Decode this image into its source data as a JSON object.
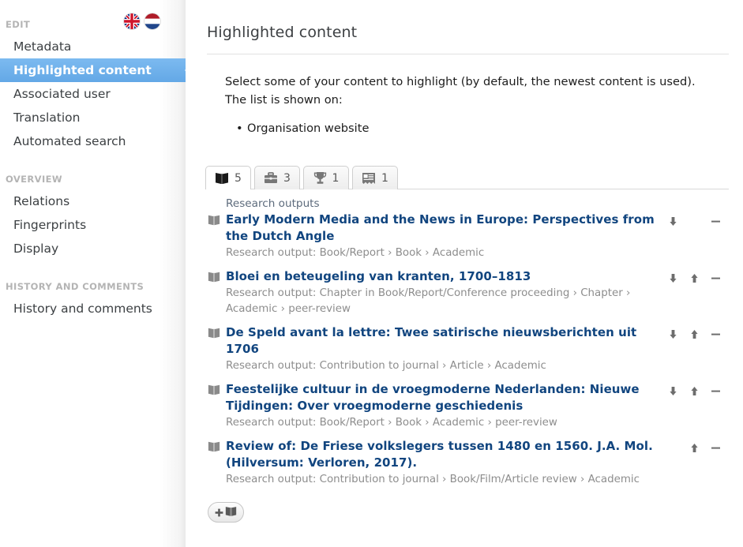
{
  "sidebar": {
    "flags": [
      {
        "name": "flag-uk",
        "label": "English"
      },
      {
        "name": "flag-nl",
        "label": "Nederlands"
      }
    ],
    "groups": [
      {
        "label": "EDIT",
        "items": [
          {
            "label": "Metadata",
            "selected": false
          },
          {
            "label": "Highlighted content",
            "selected": true
          },
          {
            "label": "Associated user",
            "selected": false
          },
          {
            "label": "Translation",
            "selected": false
          },
          {
            "label": "Automated search",
            "selected": false
          }
        ]
      },
      {
        "label": "OVERVIEW",
        "items": [
          {
            "label": "Relations",
            "selected": false
          },
          {
            "label": "Fingerprints",
            "selected": false
          },
          {
            "label": "Display",
            "selected": false
          }
        ]
      },
      {
        "label": "HISTORY AND COMMENTS",
        "items": [
          {
            "label": "History and comments",
            "selected": false
          }
        ]
      }
    ]
  },
  "main": {
    "title": "Highlighted content",
    "intro": "Select some of your content to highlight (by default, the newest content is used). The list is shown on:",
    "bullets": [
      "Organisation website"
    ],
    "tabs": [
      {
        "icon": "book-icon",
        "count": "5",
        "active": true
      },
      {
        "icon": "briefcase-icon",
        "count": "3",
        "active": false
      },
      {
        "icon": "trophy-icon",
        "count": "1",
        "active": false
      },
      {
        "icon": "press-clipping-icon",
        "count": "1",
        "active": false
      }
    ],
    "section_label": "Research outputs",
    "rows": [
      {
        "title": "Early Modern Media and the News in Europe: Perspectives from the Dutch Angle",
        "meta": "Research output: Book/Report › Book › Academic",
        "actions": {
          "down": true,
          "up": false,
          "remove": true
        }
      },
      {
        "title": "Bloei en beteugeling van kranten, 1700–1813",
        "meta": "Research output: Chapter in Book/Report/Conference proceeding › Chapter › Academic › peer-review",
        "actions": {
          "down": true,
          "up": true,
          "remove": true
        }
      },
      {
        "title": "De Speld avant la lettre: Twee satirische nieuwsberichten uit 1706",
        "meta": "Research output: Contribution to journal › Article › Academic",
        "actions": {
          "down": true,
          "up": true,
          "remove": true
        }
      },
      {
        "title": "Feestelijke cultuur in de vroegmoderne Nederlanden: Nieuwe Tijdingen: Over vroegmoderne geschiedenis",
        "meta": "Research output: Book/Report › Book › Academic › peer-review",
        "actions": {
          "down": true,
          "up": true,
          "remove": true
        }
      },
      {
        "title": "Review of: De Friese volkslegers tussen 1480 en 1560. J.A. Mol. (Hilversum: Verloren, 2017).",
        "meta": "Research output: Contribution to journal › Book/Film/Article review › Academic",
        "actions": {
          "down": false,
          "up": true,
          "remove": true
        }
      }
    ],
    "add_button": {
      "name": "add-research-output-button",
      "icons": "plus-book-icon"
    }
  },
  "colors": {
    "selected_nav": "#63a8e6",
    "link": "#11457f",
    "meta_text": "#8d8d8d",
    "group_label": "#b4b4b4"
  }
}
